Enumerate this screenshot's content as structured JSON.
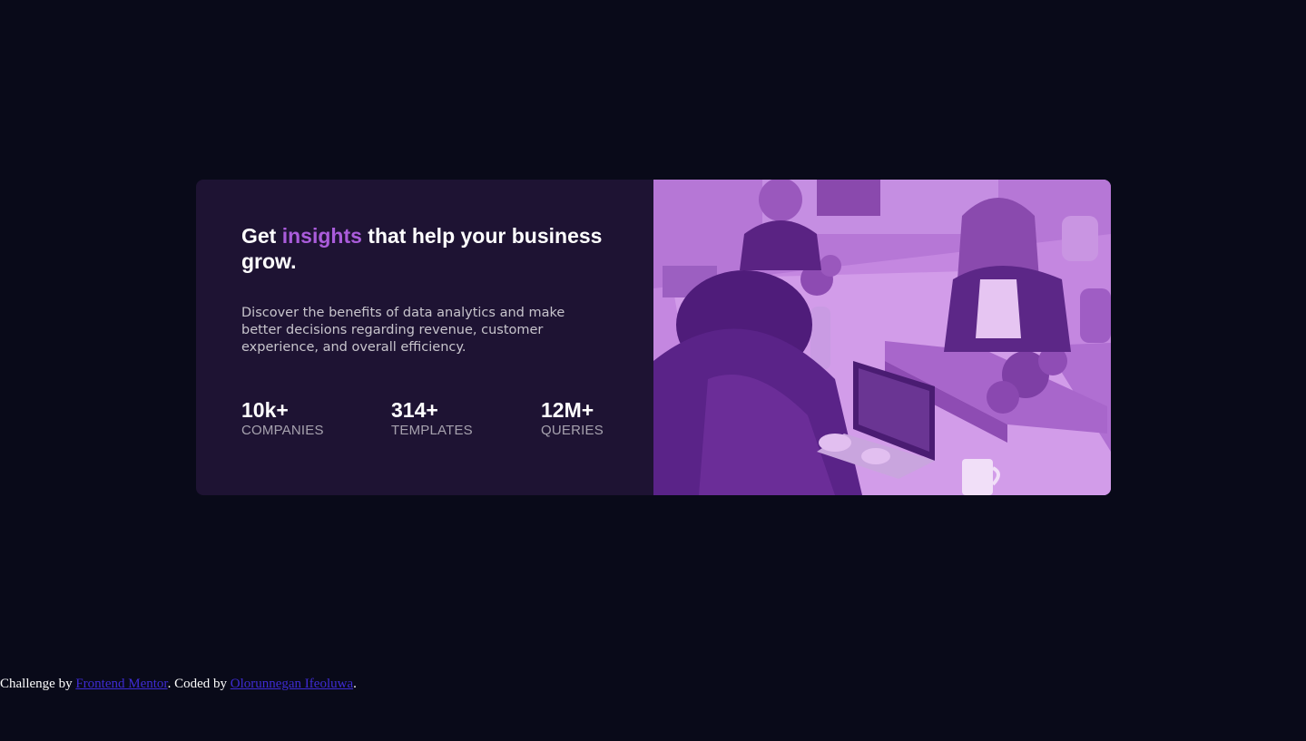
{
  "card": {
    "headline": {
      "before": "Get ",
      "accent": "insights",
      "after": " that help your business grow."
    },
    "description": "Discover the benefits of data analytics and make better decisions regarding revenue, customer experience, and overall efficiency.",
    "stats": [
      {
        "value": "10k+",
        "label": "COMPANIES"
      },
      {
        "value": "314+",
        "label": "TEMPLATES"
      },
      {
        "value": "12M+",
        "label": "QUERIES"
      }
    ]
  },
  "footer": {
    "prefix": "Challenge by ",
    "link1": "Frontend Mentor",
    "middle": ". Coded by ",
    "link2": "Olorunnegan Ifeoluwa",
    "suffix": "."
  },
  "colors": {
    "page_background": "#090a19",
    "card_background": "#1e1333",
    "accent": "#aa5cdb",
    "image_overlay": "#aa5cdb"
  }
}
